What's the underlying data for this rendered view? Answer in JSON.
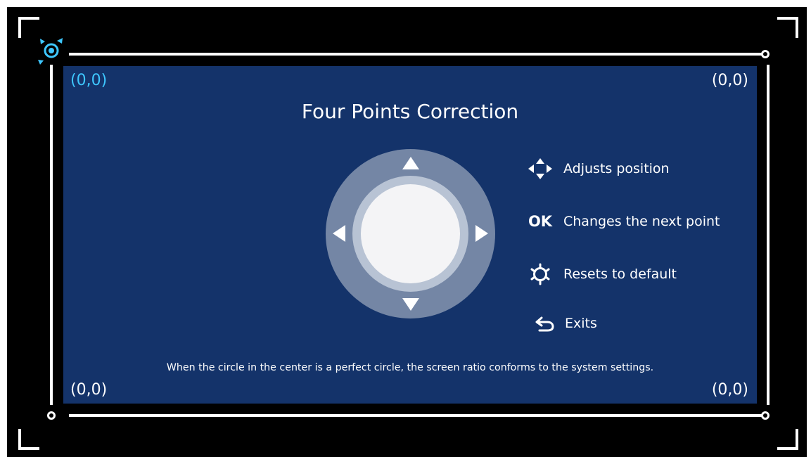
{
  "panel": {
    "title": "Four Points Correction",
    "coordinates": {
      "top_left": "(0,0)",
      "top_right": "(0,0)",
      "bottom_left": "(0,0)",
      "bottom_right": "(0,0)"
    },
    "help_items": [
      {
        "icon": "direction-arrows-icon",
        "label": "Adjusts position"
      },
      {
        "icon": "ok-key-icon",
        "icon_text": "OK",
        "label": "Changes the next point"
      },
      {
        "icon": "reset-icon",
        "label": "Resets to default"
      },
      {
        "icon": "back-arrow-icon",
        "label": "Exits"
      }
    ],
    "footnote": "When the circle in the center is a perfect circle, the screen ratio conforms to the system settings."
  },
  "colors": {
    "screen_background": "#000000",
    "panel_background": "#14336a",
    "active_point": "#3ec7ff",
    "wheel_outer": "#7486a5",
    "wheel_inner_ring": "#b8c3d4",
    "wheel_center": "#f4f4f6",
    "text": "#ffffff"
  },
  "active_corner": "top-left"
}
